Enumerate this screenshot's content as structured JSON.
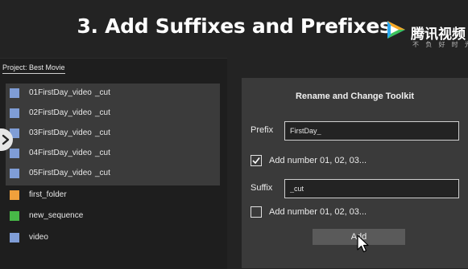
{
  "title": "3. Add Suffixes and Prefixes",
  "watermark": {
    "main": "腾讯视频",
    "sub": "不 负 好 时 光"
  },
  "project_panel": {
    "tab_label": "Project: Best Movie",
    "selected_items": [
      {
        "name": "01FirstDay_video",
        "suffix": "_cut"
      },
      {
        "name": "02FirstDay_video",
        "suffix": "_cut"
      },
      {
        "name": "03FirstDay_video",
        "suffix": "_cut"
      },
      {
        "name": "04FirstDay_video",
        "suffix": "_cut"
      },
      {
        "name": "05FirstDay_video",
        "suffix": "_cut"
      }
    ],
    "items": [
      {
        "name": "first_folder",
        "icon": "folder-icon"
      },
      {
        "name": "new_sequence",
        "icon": "sequence-icon"
      },
      {
        "name": "video",
        "icon": "video-clip-icon"
      }
    ]
  },
  "toolkit": {
    "title": "Rename and Change Toolkit",
    "prefix_label": "Prefix",
    "prefix_value": "FirstDay_",
    "prefix_number_checkbox": {
      "label": "Add number 01, 02, 03...",
      "checked": true
    },
    "suffix_label": "Suffix",
    "suffix_value": "_cut",
    "suffix_number_checkbox": {
      "label": "Add number 01, 02, 03...",
      "checked": false
    },
    "add_button": "Add"
  },
  "colors": {
    "clip": "#7f9dd6",
    "folder": "#f0a03c",
    "sequence": "#47b947",
    "selection": "#3b3b3b",
    "toolkit_bg": "#3a3a3a"
  }
}
